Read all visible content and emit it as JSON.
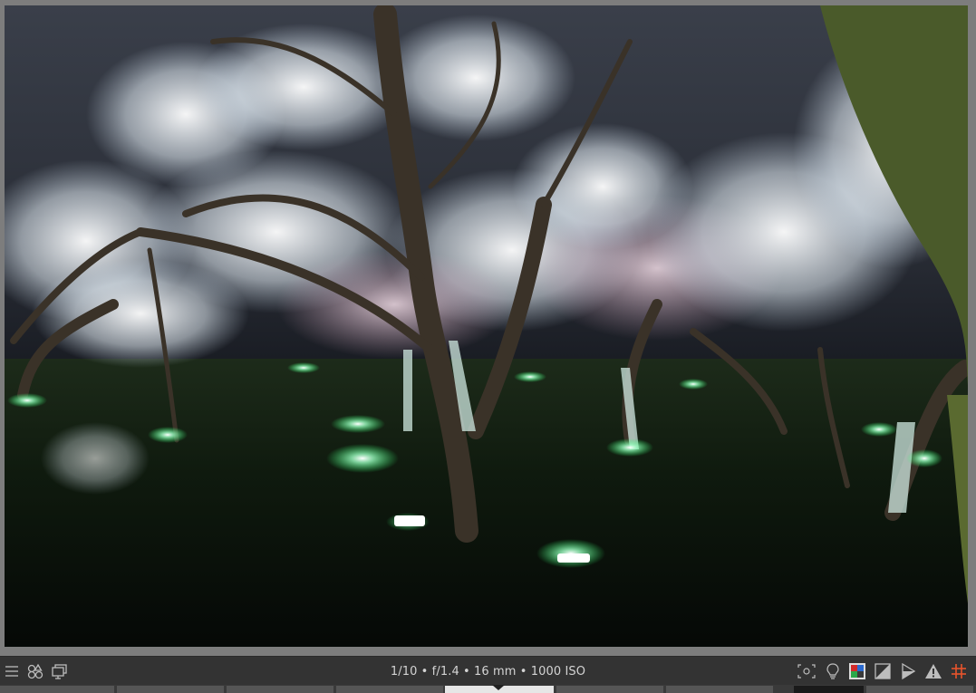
{
  "bottom_bar": {
    "exif_text": "1/10 • f/1.4 • 16 mm • 1000 ISO",
    "left_icons": [
      "hamburger-menu-icon",
      "color-shapes-icon",
      "display-monitor-icon"
    ],
    "right_icons": [
      "focus-peaking-icon",
      "lightbulb-icon",
      "color-assessment-icon",
      "softproof-icon",
      "gamut-check-icon",
      "overexposure-warning-icon",
      "guides-grid-icon"
    ]
  },
  "colors": {
    "panel_bg": "#333333",
    "viewport_bg": "#7d7d7d",
    "accent_grid": "#e8542c",
    "icon_fg": "#bdbdbd"
  }
}
